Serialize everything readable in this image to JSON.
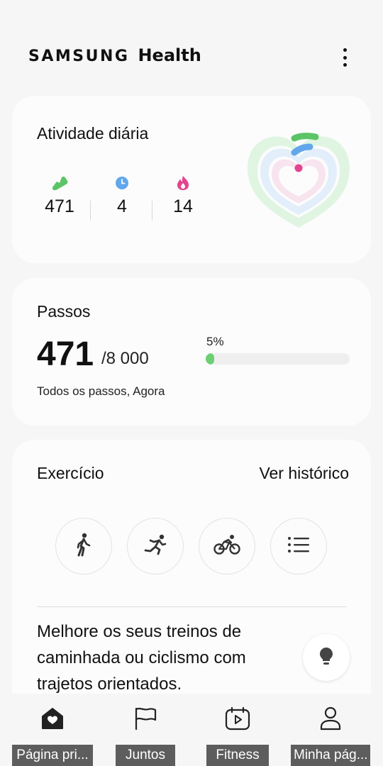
{
  "header": {
    "brand": "SAMSUNG",
    "product": "Health",
    "menu_icon": "more-vertical-icon"
  },
  "activity": {
    "title": "Atividade diária",
    "metrics": [
      {
        "icon": "steps-shoe-icon",
        "color": "#5bc466",
        "value": "471"
      },
      {
        "icon": "clock-icon",
        "color": "#62a6ec",
        "value": "4"
      },
      {
        "icon": "flame-icon",
        "color": "#e2448f",
        "value": "14"
      }
    ],
    "ring_colors": [
      "#5bc466",
      "#62a6ec",
      "#e2448f"
    ]
  },
  "steps": {
    "title": "Passos",
    "count": "471",
    "goal": "/8 000",
    "subtitle": "Todos os passos, Agora",
    "progress_label": "5%",
    "progress_fraction": 0.05,
    "accent": "#6ccf72"
  },
  "exercise": {
    "title": "Exercício",
    "history_link": "Ver histórico",
    "buttons": [
      {
        "icon": "walking-icon"
      },
      {
        "icon": "running-icon"
      },
      {
        "icon": "cycling-icon"
      },
      {
        "icon": "list-icon"
      }
    ],
    "tip": "Melhore os seus treinos de caminhada ou ciclismo com trajetos orientados.",
    "tip_icon": "lightbulb-icon"
  },
  "nav": [
    {
      "label": "Página pri...",
      "icon": "home-heart-icon"
    },
    {
      "label": "Juntos",
      "icon": "flag-icon"
    },
    {
      "label": "Fitness",
      "icon": "calendar-play-icon"
    },
    {
      "label": "Minha pág...",
      "icon": "person-icon"
    }
  ]
}
